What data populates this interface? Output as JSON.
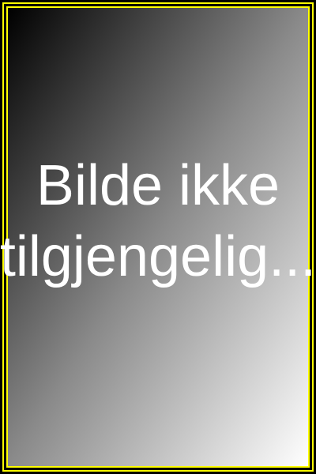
{
  "placeholder": {
    "line1": "Bilde ikke",
    "line2": "tilgjengelig..."
  },
  "colors": {
    "border": "#ffff00",
    "gradient_start": "#000000",
    "gradient_end": "#ffffff",
    "text": "#ffffff"
  }
}
